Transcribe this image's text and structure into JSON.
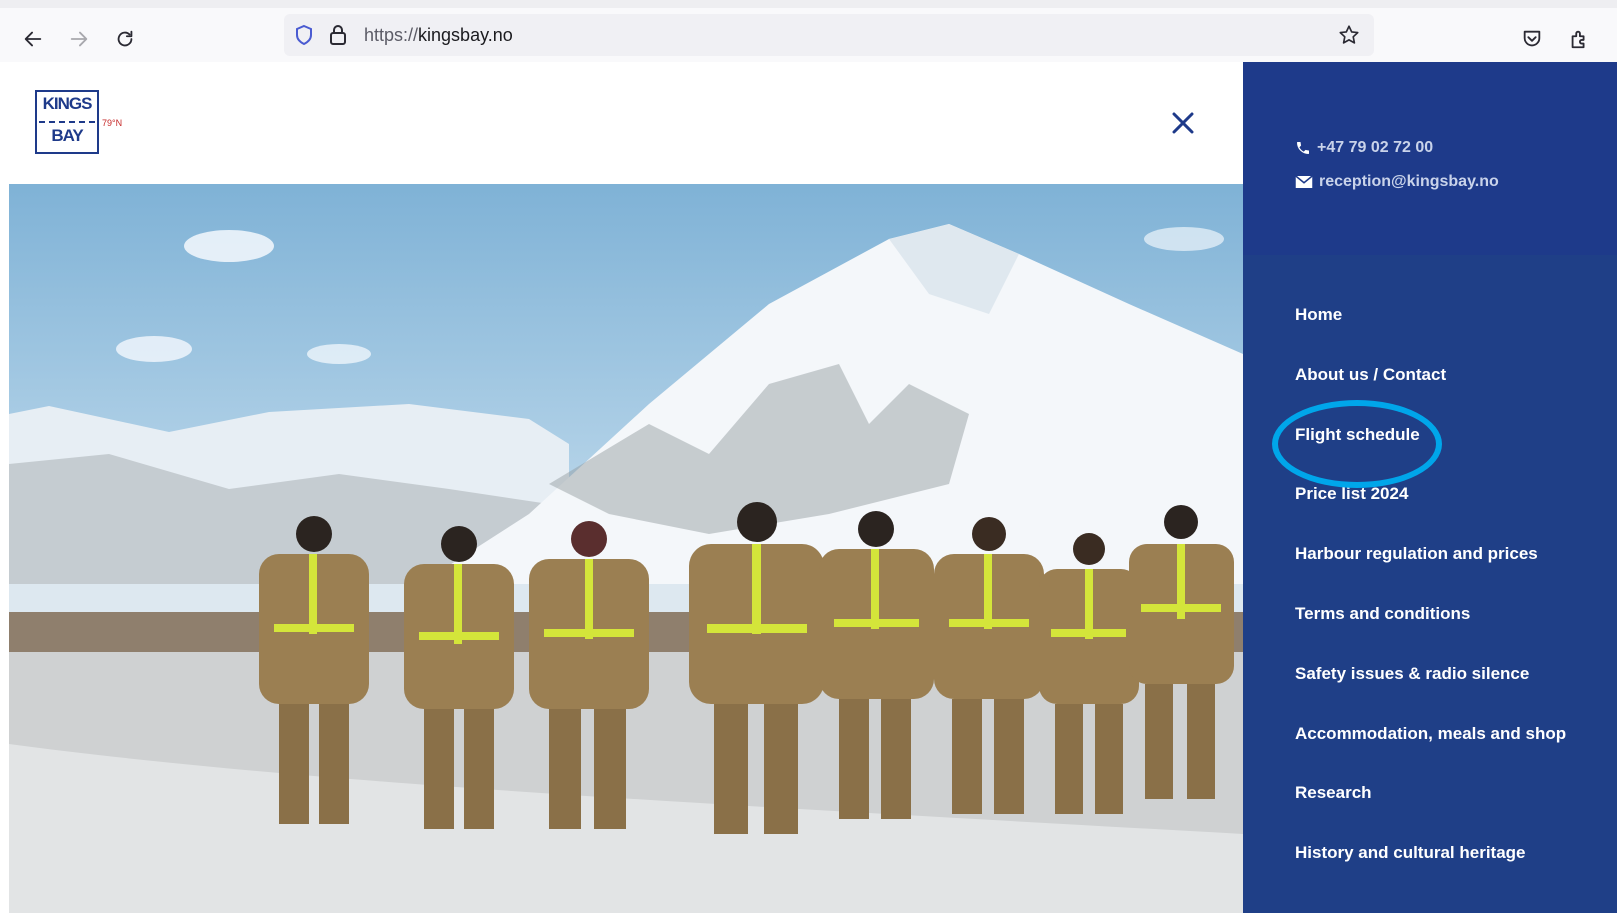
{
  "browser": {
    "url_protocol": "https://",
    "url_host": "kingsbay.no"
  },
  "logo": {
    "line1": "KINGS",
    "line2": "BAY",
    "latitude": "79°N"
  },
  "contact": {
    "phone": "+47 79 02 72 00",
    "email": "reception@kingsbay.no"
  },
  "menu": {
    "items": [
      {
        "label": "Home"
      },
      {
        "label": "About us / Contact"
      },
      {
        "label": "Flight schedule"
      },
      {
        "label": "Price list 2024"
      },
      {
        "label": "Harbour regulation and prices"
      },
      {
        "label": "Terms and conditions"
      },
      {
        "label": "Safety issues & radio silence"
      },
      {
        "label": "Accommodation, meals and shop"
      },
      {
        "label": "Research"
      },
      {
        "label": "History and cultural heritage"
      }
    ]
  },
  "colors": {
    "sidebar": "#1f3f87",
    "highlight": "#00a6ea"
  }
}
